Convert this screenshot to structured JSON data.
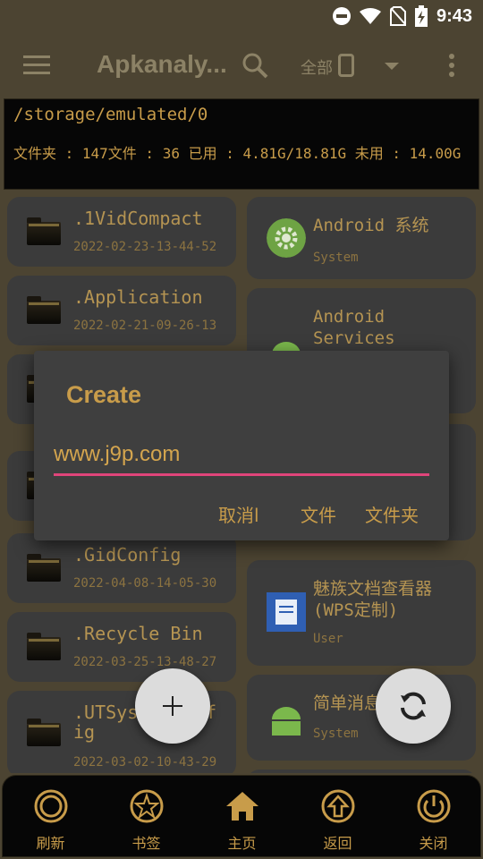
{
  "status": {
    "time": "9:43"
  },
  "appbar": {
    "title": "Apkanaly...",
    "scope": "全部"
  },
  "path": {
    "current": "/storage/emulated/0",
    "stats": "文件夹 : 147文件 : 36    已用 : 4.81G/18.81G  未用 : 14.00G"
  },
  "folders": [
    {
      "name": ".1VidCompact",
      "date": "2022-02-23-13-44-52"
    },
    {
      "name": ".Application",
      "date": "2022-02-21-09-26-13"
    },
    {
      "name": ".GidConfig",
      "date": "2022-04-08-14-05-30"
    },
    {
      "name": ".Recycle Bin",
      "date": "2022-03-25-13-48-27"
    },
    {
      "name": ".UTSys..fig",
      "name_line1": ".UTSys",
      "name_tail": "f",
      "name_line2": "ig",
      "date": "2022-03-02-10-43-29"
    }
  ],
  "apps": [
    {
      "name": "Android 系统",
      "type": "System"
    },
    {
      "name_line1": "Android",
      "name_line2": "Services",
      "type": ""
    },
    {
      "name_line1": "魅族文档查看器",
      "name_line2": "(WPS定制)",
      "type": "User"
    },
    {
      "name": "简单消息",
      "type": "System"
    }
  ],
  "dialog": {
    "title": "Create",
    "input_value": "www.j9p.com",
    "cancel": "取消l",
    "file": "文件",
    "folder": "文件夹"
  },
  "nav": [
    {
      "label": "刷新",
      "icon": "refresh-ring-icon"
    },
    {
      "label": "书签",
      "icon": "star-icon"
    },
    {
      "label": "主页",
      "icon": "home-icon"
    },
    {
      "label": "返回",
      "icon": "up-arrow-icon"
    },
    {
      "label": "关闭",
      "icon": "power-icon"
    }
  ],
  "colors": {
    "accent": "#c89c4a",
    "background": "#4c4432",
    "panel": "#060606",
    "input_underline": "#e0457a"
  }
}
